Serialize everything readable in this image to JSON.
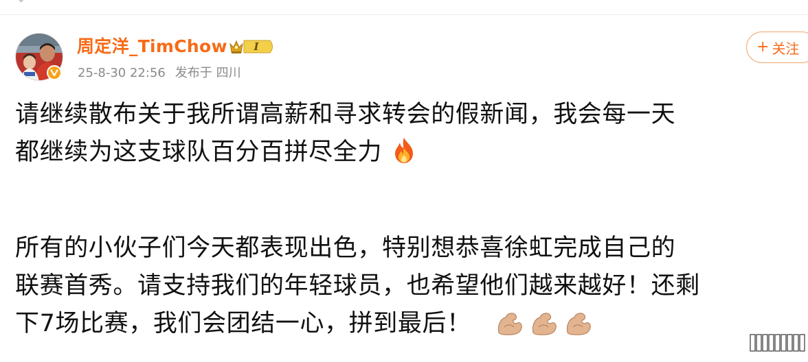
{
  "post": {
    "author": {
      "name": "周定洋_TimChow",
      "vip_label": "I",
      "avatar_icon": "avatar-photo",
      "verified_icon": "verified-v-icon"
    },
    "meta": {
      "time": "25-8-30 22:56",
      "location": "发布于 四川"
    },
    "follow_button": {
      "plus": "+",
      "label": "关注"
    },
    "paragraphs": [
      {
        "lines": [
          "请继续散布关于我所谓高薪和寻求转会的假新闻，我会每一天",
          "都继续为这支球队百分百拼尽全力"
        ],
        "trailing_emoji": "🔥"
      },
      {
        "lines": [
          "所有的小伙子们今天都表现出色，特别想恭喜徐虹完成自己的",
          "联赛首秀。请支持我们的年轻球员，也希望他们越来越好！还剩",
          "下7场比赛，我们会团结一心，拼到最后！"
        ],
        "trailing_emoji": "💪💪💪"
      }
    ]
  },
  "colors": {
    "username": "#f76b17",
    "meta_text": "#8a8a8a",
    "follow_border": "#f2a56a",
    "verified": "#f7a21b"
  }
}
